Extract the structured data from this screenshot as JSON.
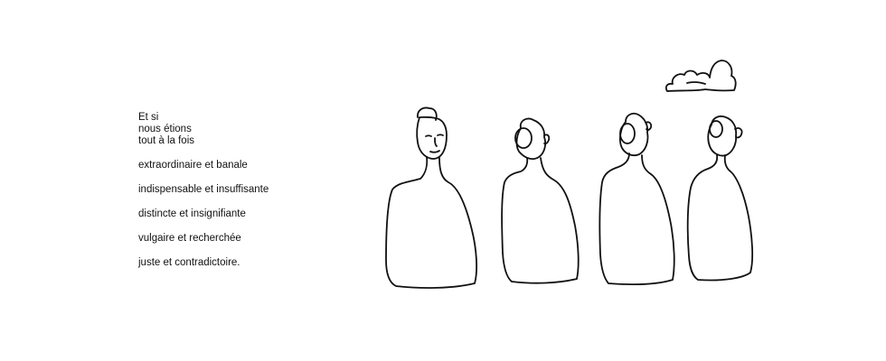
{
  "poem": {
    "line1": "Et si",
    "line2": "nous étions",
    "line3": "tout à la fois",
    "line4": "extraordinaire et banale",
    "line5": "indispensable et insuffisante",
    "line6": "distincte et insignifiante",
    "line7": "vulgaire et recherchée",
    "line8": "juste et contradictoire."
  },
  "illustration": {
    "figure_count": 4,
    "cloud_count": 1,
    "ink_color": "#111111",
    "background_color": "#ffffff"
  }
}
